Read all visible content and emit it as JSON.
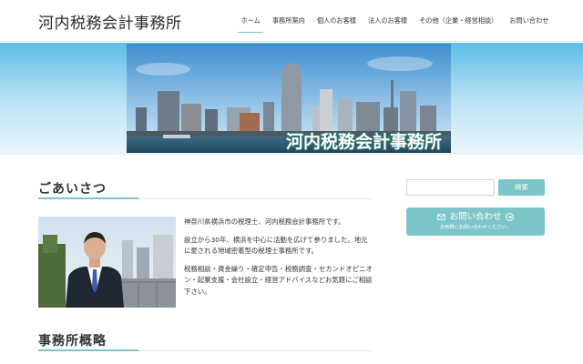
{
  "site": {
    "title": "河内税務会計事務所"
  },
  "nav": {
    "items": [
      {
        "label": "ホーム",
        "active": true
      },
      {
        "label": "事務所案内",
        "active": false
      },
      {
        "label": "個人のお客様",
        "active": false
      },
      {
        "label": "法人のお客様",
        "active": false
      },
      {
        "label": "その他（企業・経営相談）",
        "active": false
      },
      {
        "label": "お問い合わせ",
        "active": false
      }
    ]
  },
  "hero": {
    "overlay_text": "河内税務会計事務所"
  },
  "main": {
    "greeting_heading": "ごあいさつ",
    "greeting_paragraphs": [
      "神奈川県横浜市の税理士、河内税務会計事務所です。",
      "設立から30年、横浜を中心に活動を広げて参りました。地元に愛される地域密着型の税理士事務所です。",
      "税務相談・資金繰り・確定申告・税務調査・セカンドオピニオン・起業支援・会社設立・経営アドバイスなどお気軽にご相談下さい。"
    ],
    "overview_heading": "事務所概略"
  },
  "sidebar": {
    "search": {
      "placeholder": "",
      "button_label": "検索"
    },
    "contact": {
      "label": "お問い合わせ",
      "sublabel": "お気軽にお問い合わせください。"
    }
  },
  "colors": {
    "accent": "#7cc5c9",
    "sky_top": "#5dbde8",
    "text": "#333333"
  },
  "icons": [
    "envelope-icon",
    "arrow-circle-right-icon"
  ]
}
